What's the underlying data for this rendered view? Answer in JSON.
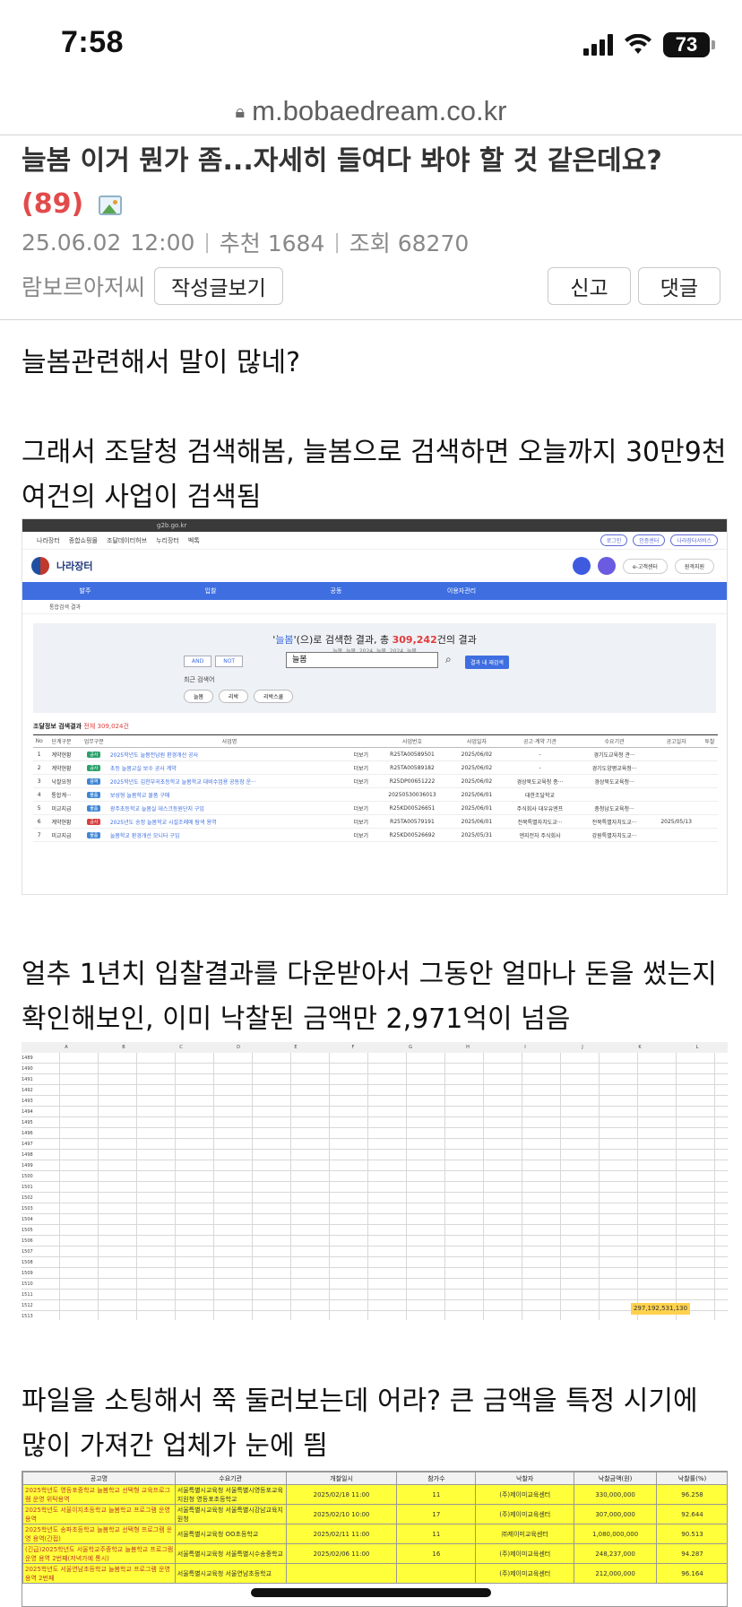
{
  "status": {
    "time": "7:58",
    "battery": "73"
  },
  "browser": {
    "url": "m.bobaedream.co.kr"
  },
  "post": {
    "title": "늘봄 이거 뭔가 좀...자세히 들여다 봐야 할 것 같은데요?",
    "comment_count": "(89)",
    "date": "25.06.02",
    "time": "12:00",
    "recommend": "추천 1684",
    "views": "조회 68270",
    "author": "람보르아저씨",
    "view_posts_button": "작성글보기",
    "report_button": "신고",
    "comment_button": "댓글"
  },
  "body": {
    "p1": "늘봄관련해서 말이 많네?",
    "p2": "그래서 조달청 검색해봄, 늘봄으로 검색하면 오늘까지 30만9천여건의 사업이 검색됨",
    "p3": "얼추 1년치 입찰결과를 다운받아서 그동안 얼마나 돈을 썼는지 확인해보인, 이미 낙찰된 금액만 2,971억이 넘음",
    "p4": "파일을 소팅해서 쭉 둘러보는데 어라? 큰 금액을 특정 시기에 많이 가져간 업체가 눈에 띔"
  },
  "shot1": {
    "address": "g2b.go.kr",
    "topnav": [
      "나라장터",
      "종합쇼핑몰",
      "조달데이터허브",
      "누리장터",
      "벡톡"
    ],
    "pills": [
      "로그인",
      "인증센터",
      "나라장터서비스"
    ],
    "logo": "나라장터",
    "customer_center": "e-고객센터",
    "remote": "원격지원",
    "menu": [
      "발주",
      "입찰",
      "공동",
      "이용자관리"
    ],
    "breadcrumb": "통합검색 결과",
    "kw": "늘봄",
    "result_pre": "'(으)로 검색한 결과, 총 ",
    "result_num": "309,242",
    "result_post": "건의 결과",
    "sub": "늘봄, 늘봄, 2024, 늘봄, 2024, 늘봄",
    "and": "AND",
    "not": "NOT",
    "input": "늘봄",
    "go": "결과 내 재검색",
    "recent_label": "최근 검색어",
    "recent": [
      "늘봄",
      "리박",
      "리박스쿨"
    ],
    "table_title": "조달정보 검색결과",
    "table_count": "전체 309,024건",
    "headers": [
      "No",
      "단계구분",
      "업무구분",
      "사업명",
      "",
      "사업번호",
      "사업일자",
      "공고·계약 기관",
      "수요기관",
      "공고일자",
      "투찰"
    ],
    "rows": [
      [
        "1",
        "계약현황",
        "공사",
        "2025학년도 늘봄전남원 환경개선 공사",
        "더보기",
        "R25TA00589501",
        "2025/06/02",
        "-",
        "경기도교육청 관···",
        "",
        ""
      ],
      [
        "2",
        "계약현황",
        "공사",
        "초등 늘봄교실 보수 공사 계약",
        "더보기",
        "R25TA00589182",
        "2025/06/02",
        "-",
        "경기도양평교육청···",
        "",
        ""
      ],
      [
        "3",
        "낙찰요청",
        "용역",
        "2025학년도 김천부곡초등학교 늘봄학교 대비수업용 공동장 운···",
        "더보기",
        "R25DP00651222",
        "2025/06/02",
        "경상북도교육청 종···",
        "경상북도교육청···",
        "",
        ""
      ],
      [
        "4",
        "통합계···",
        "물품",
        "보성형 늘봄학교 물품 구매",
        "",
        "20250530036013",
        "2025/06/01",
        "대한조달학교",
        "",
        "",
        ""
      ],
      [
        "5",
        "미교지급",
        "물품",
        "광주초등학교 늘봄실 데스크등원단지 구입",
        "더보기",
        "R25KD00526651",
        "2025/06/01",
        "주식회사 대우유엔프",
        "충청남도교육청···",
        "",
        ""
      ],
      [
        "6",
        "계약현황",
        "공사",
        "2025년도 송정 늘봄학교 시설조례에 탐색 용역",
        "더보기",
        "R25TA00579191",
        "2025/06/01",
        "전북특별자치도교···",
        "전북특별자치도교···",
        "2025/05/13",
        ""
      ],
      [
        "7",
        "미교지급",
        "물품",
        "늘봄학교 환경개선 모니터 구입",
        "더보기",
        "R25KD00526692",
        "2025/05/31",
        "엔지전자 주식회사",
        "강원특별자치도교···",
        "",
        ""
      ]
    ]
  },
  "shot2": {
    "columns": [
      "A",
      "B",
      "C",
      "D",
      "E",
      "F",
      "G",
      "H",
      "I",
      "J",
      "K",
      "L"
    ],
    "first_row": 1489,
    "last_row": 1514,
    "total": "297,192,531,130"
  },
  "shot3": {
    "headers": [
      "공고명",
      "수요기관",
      "개찰일시",
      "참가수",
      "낙찰자",
      "낙찰금액(원)",
      "낙찰률(%)"
    ],
    "rows": [
      [
        "2025학년도 영등포중학교 늘봄학교 선택형 교육프로그램 운영 위탁용역",
        "서울특별시교육청 서울특별시영등포교육지원청 영등포초등학교",
        "2025/02/18 11:00",
        "11",
        "(주)제이미교육센터",
        "330,000,000",
        "96.258"
      ],
      [
        "2025학년도 서울이지초등학교 늘봄학교 프로그램 운영 용역",
        "서울특별시교육청 서울특별시강남교육지원청",
        "2025/02/10 10:00",
        "17",
        "(주)제이미교육센터",
        "307,000,000",
        "92.644"
      ],
      [
        "2025학년도 송파초등학교 늘봄학교 선택형 프로그램 운영 용역(간접)",
        "서울특별시교육청 OO초등학교",
        "2025/02/11 11:00",
        "11",
        "㈜제이미교육센터",
        "1,080,000,000",
        "90.513"
      ],
      [
        "(긴급)2025학년도 서울학교주중학교 늘봄학교 프로그램 운영 용역 2번째(저녁가예 통시)",
        "서울특별시교육청 서울특별시수송중학교",
        "2025/02/06 11:00",
        "16",
        "(주)제이미교육센터",
        "248,237,000",
        "94.287"
      ],
      [
        "2025학년도 서울연남초등학교 늘봄학교 프로그램 운영 용역 2번째",
        "서울특별시교육청 서울연남초등학교",
        "",
        "",
        "(주)제이미교육센터",
        "212,000,000",
        "96.164"
      ]
    ]
  }
}
